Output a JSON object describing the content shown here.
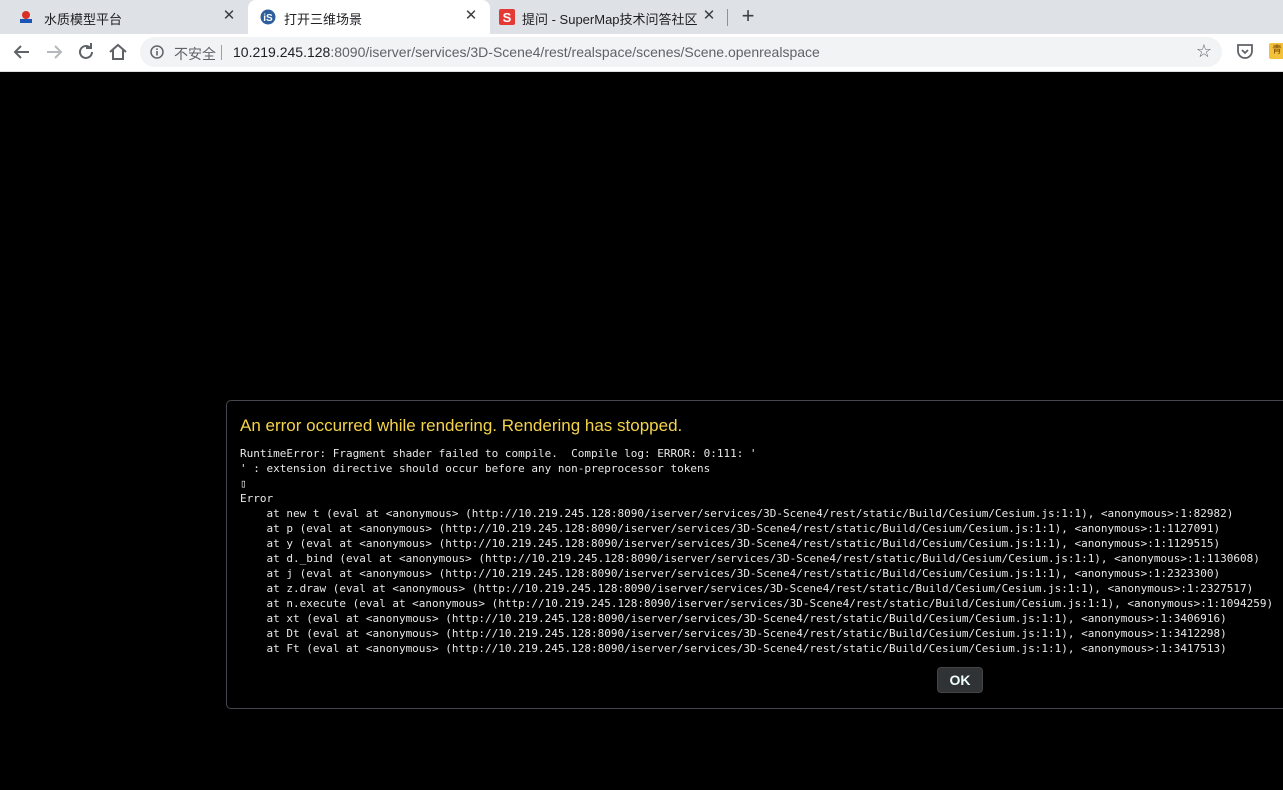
{
  "browser": {
    "tabs": [
      {
        "title": "水质模型平台",
        "favicon": "water-platform-icon",
        "active": false
      },
      {
        "title": "打开三维场景",
        "favicon": "iserver-icon",
        "active": true
      },
      {
        "title": "提问 - SuperMap技术问答社区",
        "favicon": "supermap-s-icon",
        "active": false
      }
    ],
    "new_tab_label": "+",
    "close_glyph": "✕",
    "security_label": "不安全",
    "url_host": "10.219.245.128",
    "url_rest": ":8090/iserver/services/3D-Scene4/rest/realspace/scenes/Scene.openrealspace",
    "bookmark_glyph": "☆",
    "extension_label": "青"
  },
  "error_dialog": {
    "heading": "An error occurred while rendering.  Rendering has stopped.",
    "message_lines": [
      "RuntimeError: Fragment shader failed to compile.  Compile log: ERROR: 0:111: '",
      "' : extension directive should occur before any non-preprocessor tokens",
      "▯",
      "Error",
      "    at new t (eval at <anonymous> (http://10.219.245.128:8090/iserver/services/3D-Scene4/rest/static/Build/Cesium/Cesium.js:1:1), <anonymous>:1:82982)",
      "    at p (eval at <anonymous> (http://10.219.245.128:8090/iserver/services/3D-Scene4/rest/static/Build/Cesium/Cesium.js:1:1), <anonymous>:1:1127091)",
      "    at y (eval at <anonymous> (http://10.219.245.128:8090/iserver/services/3D-Scene4/rest/static/Build/Cesium/Cesium.js:1:1), <anonymous>:1:1129515)",
      "    at d._bind (eval at <anonymous> (http://10.219.245.128:8090/iserver/services/3D-Scene4/rest/static/Build/Cesium/Cesium.js:1:1), <anonymous>:1:1130608)",
      "    at j (eval at <anonymous> (http://10.219.245.128:8090/iserver/services/3D-Scene4/rest/static/Build/Cesium/Cesium.js:1:1), <anonymous>:1:2323300)",
      "    at z.draw (eval at <anonymous> (http://10.219.245.128:8090/iserver/services/3D-Scene4/rest/static/Build/Cesium/Cesium.js:1:1), <anonymous>:1:2327517)",
      "    at n.execute (eval at <anonymous> (http://10.219.245.128:8090/iserver/services/3D-Scene4/rest/static/Build/Cesium/Cesium.js:1:1), <anonymous>:1:1094259)",
      "    at xt (eval at <anonymous> (http://10.219.245.128:8090/iserver/services/3D-Scene4/rest/static/Build/Cesium/Cesium.js:1:1), <anonymous>:1:3406916)",
      "    at Dt (eval at <anonymous> (http://10.219.245.128:8090/iserver/services/3D-Scene4/rest/static/Build/Cesium/Cesium.js:1:1), <anonymous>:1:3412298)",
      "    at Ft (eval at <anonymous> (http://10.219.245.128:8090/iserver/services/3D-Scene4/rest/static/Build/Cesium/Cesium.js:1:1), <anonymous>:1:3417513)"
    ],
    "ok_label": "OK"
  },
  "colors": {
    "tabbar_bg": "#dee1e6",
    "heading_yellow": "#f4d34a",
    "viewport_bg": "#000000"
  }
}
